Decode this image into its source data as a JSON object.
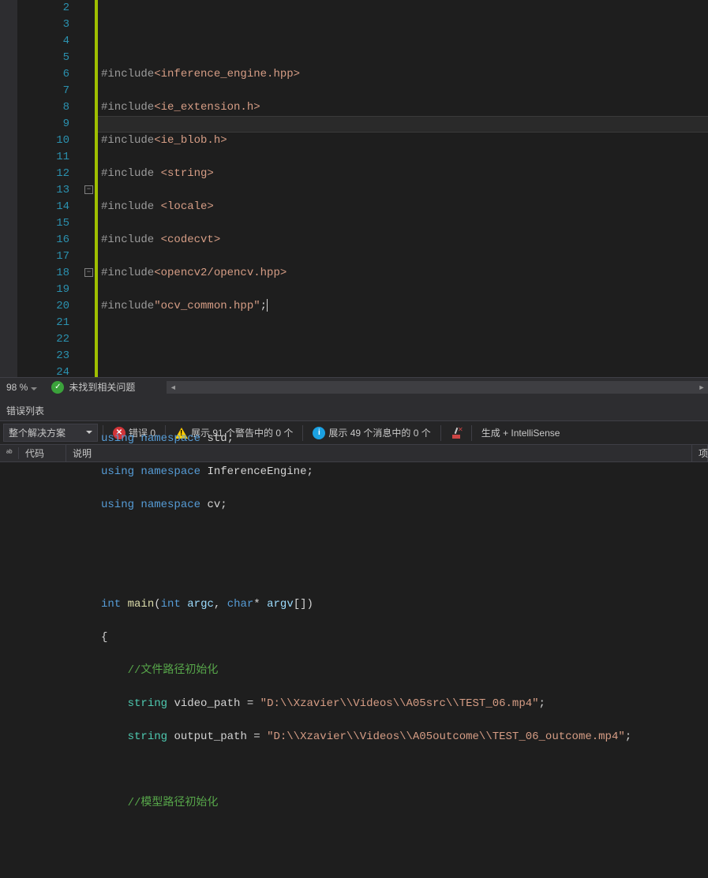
{
  "code": {
    "lines": [
      2,
      3,
      4,
      5,
      6,
      7,
      8,
      9,
      10,
      11,
      12,
      13,
      14,
      15,
      16,
      17,
      18,
      19,
      20,
      21,
      22,
      23,
      24
    ],
    "l2": {
      "pp": "#include",
      "str": "<inference_engine.hpp>"
    },
    "l3": {
      "pp": "#include",
      "str": "<ie_extension.h>"
    },
    "l4": {
      "pp": "#include",
      "str": "<ie_blob.h>"
    },
    "l5": {
      "pp": "#include ",
      "str": "<string>"
    },
    "l6": {
      "pp": "#include ",
      "str": "<locale>"
    },
    "l7": {
      "pp": "#include ",
      "str": "<codecvt>"
    },
    "l8": {
      "pp": "#include",
      "str": "<opencv2/opencv.hpp>"
    },
    "l9": {
      "pp": "#include",
      "str": "\"ocv_common.hpp\"",
      "semi": ";"
    },
    "l13": {
      "kw1": "using",
      "kw2": "namespace",
      "id": "std",
      "semi": ";"
    },
    "l14": {
      "kw1": "using",
      "kw2": "namespace",
      "id": "InferenceEngine",
      "semi": ";"
    },
    "l15": {
      "kw1": "using",
      "kw2": "namespace",
      "id": "cv",
      "semi": ";"
    },
    "l18": {
      "type": "int",
      "func": "main",
      "p1t": "int",
      "p1n": "argc",
      "p2t": "char",
      "p2n": "argv"
    },
    "l19": {
      "brace": "{"
    },
    "l20": {
      "com": "//文件路径初始化"
    },
    "l21": {
      "type": "string",
      "var": "video_path",
      "eq": "=",
      "str": "\"D:\\\\Xzavier\\\\Videos\\\\A05src\\\\TEST_06.mp4\"",
      "semi": ";"
    },
    "l22": {
      "type": "string",
      "var": "output_path",
      "eq": "=",
      "str": "\"D:\\\\Xzavier\\\\Videos\\\\A05outcome\\\\TEST_06_outcome.mp4\"",
      "semi": ";"
    },
    "l24": {
      "com": "//模型路径初始化"
    }
  },
  "status": {
    "zoom": "98 %",
    "no_issues": "未找到相关问题"
  },
  "errors": {
    "title": "错误列表",
    "scope": "整个解决方案",
    "err_label": "错误 0",
    "warn_label": "展示 91 个警告中的 0 个",
    "msg_label": "展示 49 个消息中的 0 个",
    "build_label": "生成 + IntelliSense",
    "col_code": "代码",
    "col_desc": "说明",
    "col_proj": "项"
  }
}
